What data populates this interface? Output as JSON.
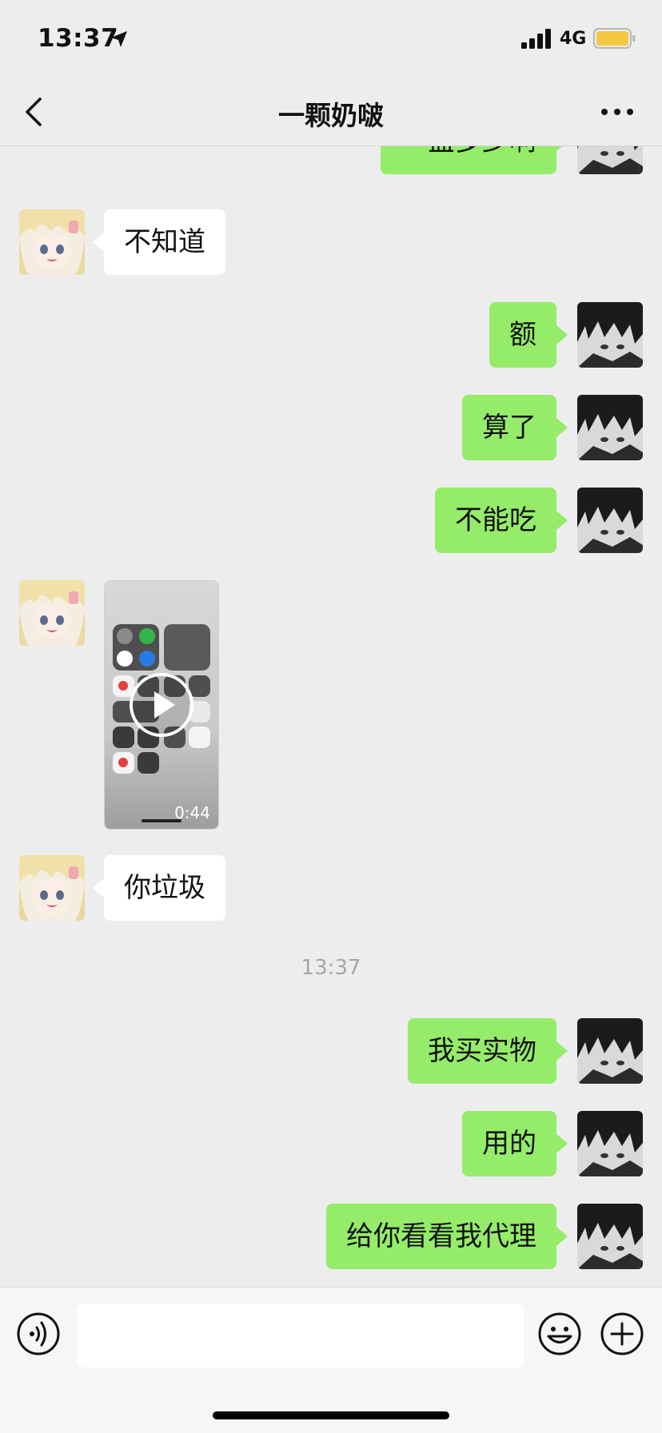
{
  "status_bar": {
    "time": "13:37",
    "network": "4G",
    "battery_color": "#f5c842"
  },
  "header": {
    "title": "一颗奶啵"
  },
  "chat": {
    "messages": [
      {
        "from": "me",
        "text": "一盒多少啊"
      },
      {
        "from": "them",
        "text": "不知道"
      },
      {
        "from": "me",
        "text": "额"
      },
      {
        "from": "me",
        "text": "算了"
      },
      {
        "from": "me",
        "text": "不能吃"
      },
      {
        "from": "them",
        "type": "video",
        "duration": "0:44"
      },
      {
        "from": "them",
        "text": "你垃圾"
      },
      {
        "from": "me",
        "text": "我买实物"
      },
      {
        "from": "me",
        "text": "用的"
      },
      {
        "from": "me",
        "text": "给你看看我代理"
      }
    ],
    "timestamp": "13:37"
  },
  "input_bar": {
    "placeholder": ""
  },
  "colors": {
    "outgoing_bubble": "#95ec69",
    "incoming_bubble": "#ffffff",
    "background": "#ededed"
  }
}
